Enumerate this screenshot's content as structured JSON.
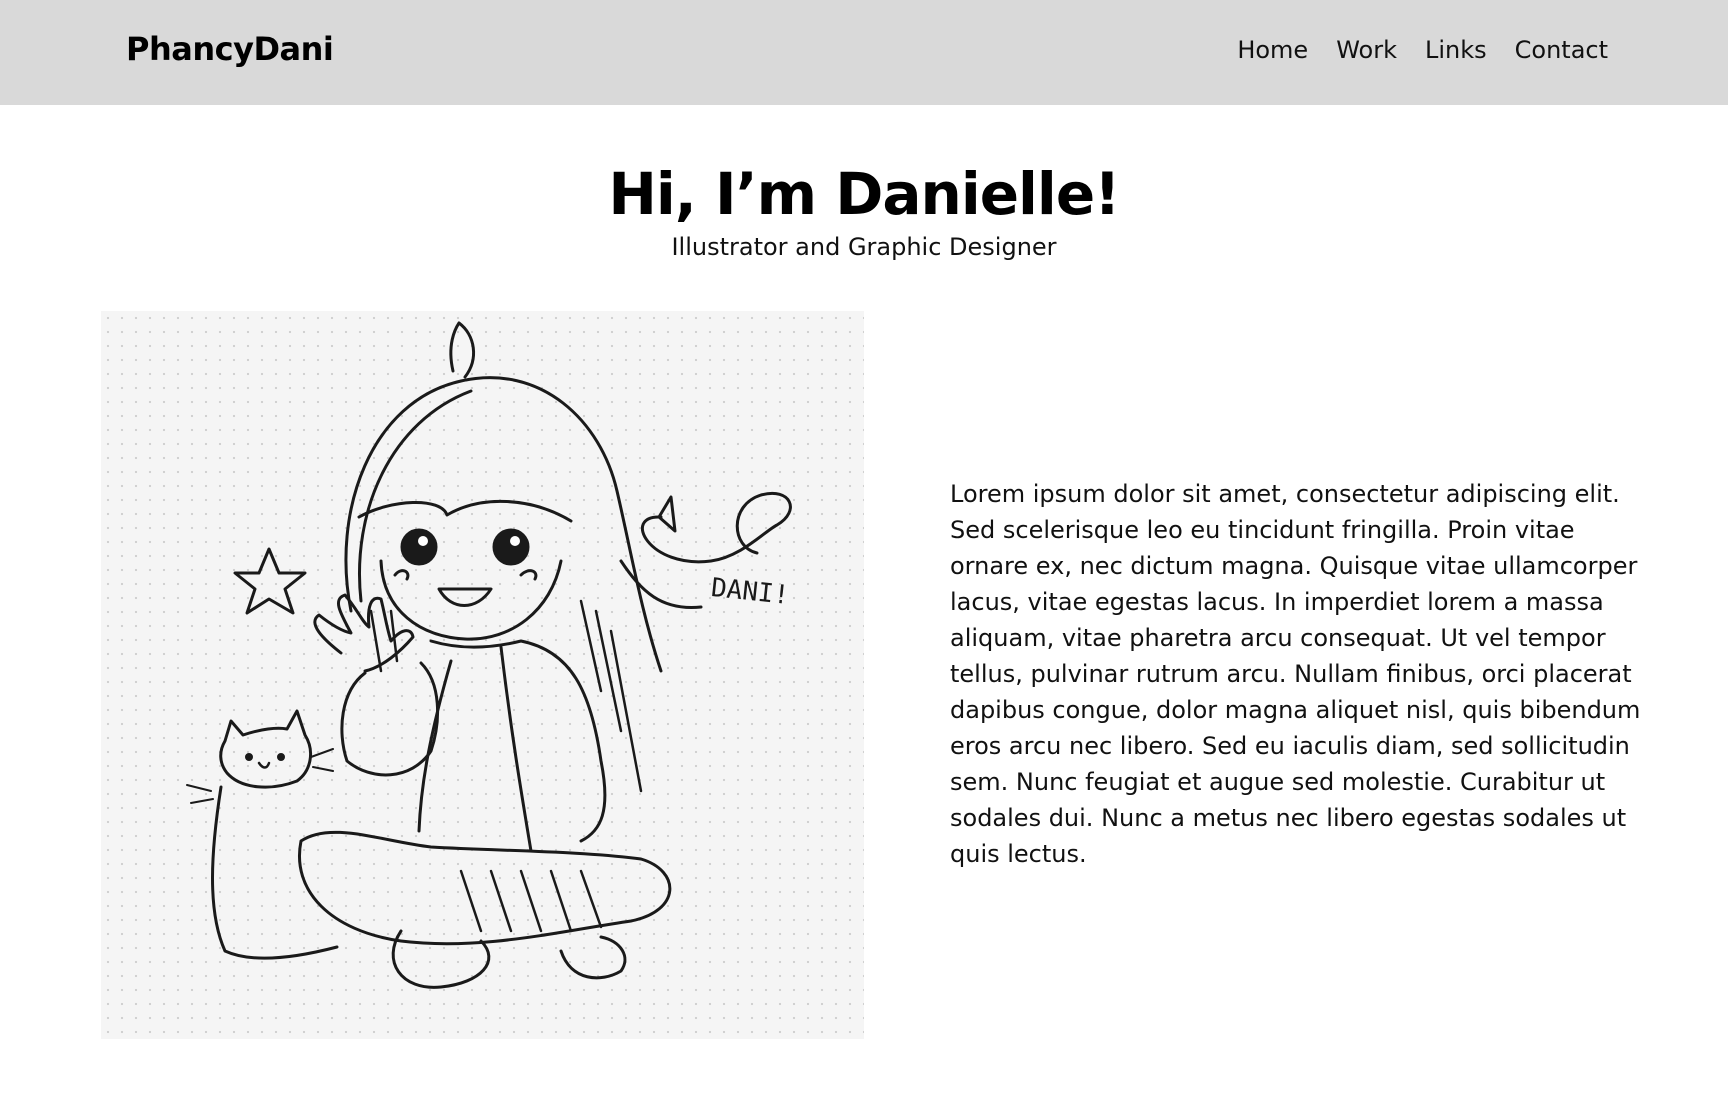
{
  "header": {
    "brand": "PhancyDani",
    "nav": [
      {
        "label": "Home"
      },
      {
        "label": "Work"
      },
      {
        "label": "Links"
      },
      {
        "label": "Contact"
      }
    ]
  },
  "hero": {
    "title": "Hi, I’m Danielle!",
    "subtitle": "Illustrator and Graphic Designer"
  },
  "illustration": {
    "signature": "DANI!"
  },
  "bio": {
    "text": "Lorem ipsum dolor sit amet, consectetur adipiscing elit. Sed scelerisque leo eu tincidunt fringilla. Proin vitae ornare ex, nec dictum magna. Quisque vitae ullamcorper lacus, vitae egestas lacus. In imperdiet lorem a massa aliquam, vitae pharetra arcu consequat. Ut vel tempor tellus, pulvinar rutrum arcu. Nullam finibus, orci placerat dapibus congue, dolor magna aliquet nisl, quis bibendum eros arcu nec libero. Sed eu iaculis diam, sed sollicitudin sem. Nunc feugiat et augue sed molestie. Curabitur ut sodales dui. Nunc a metus nec libero egestas sodales ut quis lectus."
  }
}
